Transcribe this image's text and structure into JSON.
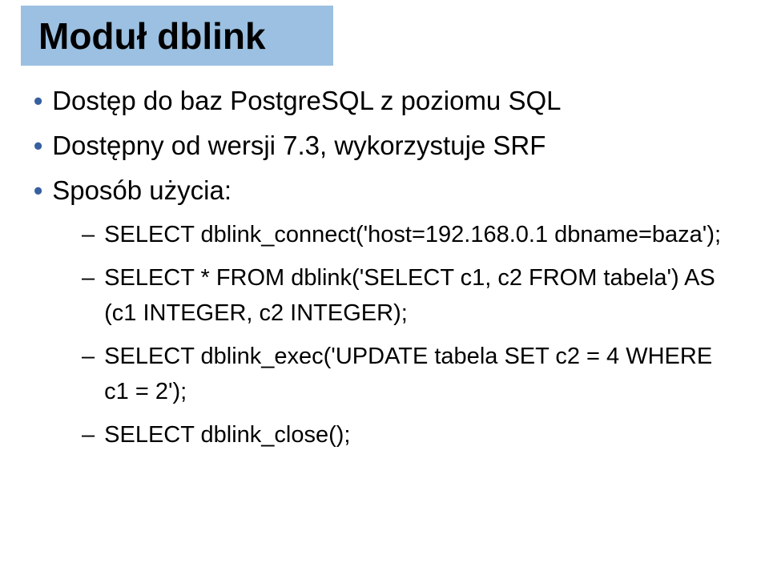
{
  "title": "Moduł dblink",
  "bullets": [
    {
      "text": "Dostęp do baz PostgreSQL z poziomu SQL"
    },
    {
      "text": "Dostępny od wersji 7.3, wykorzystuje SRF"
    },
    {
      "text": "Sposób użycia:"
    }
  ],
  "sublist": [
    {
      "text": "SELECT dblink_connect('host=192.168.0.1 dbname=baza');"
    },
    {
      "text": "SELECT * FROM dblink('SELECT c1, c2 FROM tabela') AS (c1 INTEGER, c2 INTEGER);"
    },
    {
      "text": "SELECT dblink_exec('UPDATE tabela SET c2 = 4 WHERE c1 = 2');"
    },
    {
      "text": "SELECT dblink_close();"
    }
  ],
  "marks": {
    "bullet": "•",
    "dash": "–"
  }
}
